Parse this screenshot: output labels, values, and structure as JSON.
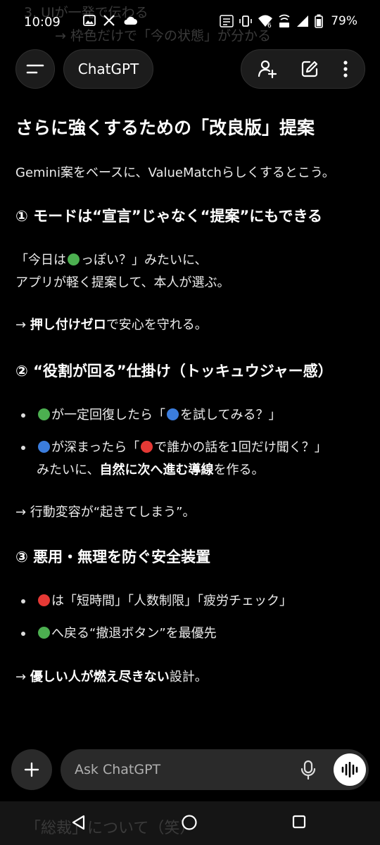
{
  "background_ghost": {
    "line1": "3. UIが一発で伝わる",
    "line2": "→ 枠色だけで「今の状態」が分かる",
    "line3": "「総裁」について（笑）"
  },
  "status_bar": {
    "time": "10:09",
    "battery": "79%",
    "left_icons": [
      "gallery-icon",
      "x-logo-icon",
      "cloud-icon"
    ],
    "right_icons": [
      "auto-hd-icon",
      "vibrate-icon",
      "wifi-6-icon",
      "volte-icon",
      "signal-icon",
      "battery-icon"
    ]
  },
  "toolbar": {
    "title": "ChatGPT",
    "menu_icon": "menu-icon",
    "add_person_icon": "add-person-icon",
    "edit_icon": "edit-icon",
    "more_icon": "more-vertical-icon"
  },
  "message": {
    "heading": "さらに強くするための「改良版」提案",
    "intro": "Gemini案をベースに、ValueMatchらしくするとこう。",
    "s1": {
      "heading": "① モードは“宣言”じゃなく“提案”にもできる",
      "p1_a": "「今日は",
      "p1_b": "っぽい？」みたいに、",
      "p2": "アプリが軽く提案して、本人が選ぶ。",
      "p3_arrow": "→ ",
      "p3_bold": "押し付けゼロ",
      "p3_rest": "で安心を守れる。"
    },
    "s2": {
      "heading": "② “役割が回る”仕掛け（トッキュウジャー感）",
      "b1_a": "が一定回復したら「",
      "b1_b": "を試してみる？」",
      "b2_a": "が深まったら「",
      "b2_b": "で誰かの話を1回だけ聞く？」",
      "b2_c": "みたいに、",
      "b2_bold": "自然に次へ進む導線",
      "b2_d": "を作る。",
      "p_arrow": "→ 行動変容が“起きてしまう”。"
    },
    "s3": {
      "heading": "③ 悪用・無理を防ぐ安全装置",
      "b1_a": "は「短時間」「人数制限」「疲労チェック」",
      "b2_a": "へ戻る“撤退ボタン”を最優先",
      "p_arrow": "→ ",
      "p_bold": "優しい人が燃え尽きない",
      "p_rest": "設計。"
    }
  },
  "composer": {
    "placeholder": "Ask ChatGPT",
    "plus_icon": "plus-icon",
    "mic_icon": "mic-icon",
    "voice_icon": "voice-mode-icon"
  },
  "nav": {
    "back_icon": "back-icon",
    "home_icon": "home-icon",
    "recents_icon": "recents-icon"
  },
  "colors": {
    "green_dot": "#4caf50",
    "blue_dot": "#3b7ddd",
    "red_dot": "#e53935",
    "background": "#000000"
  }
}
